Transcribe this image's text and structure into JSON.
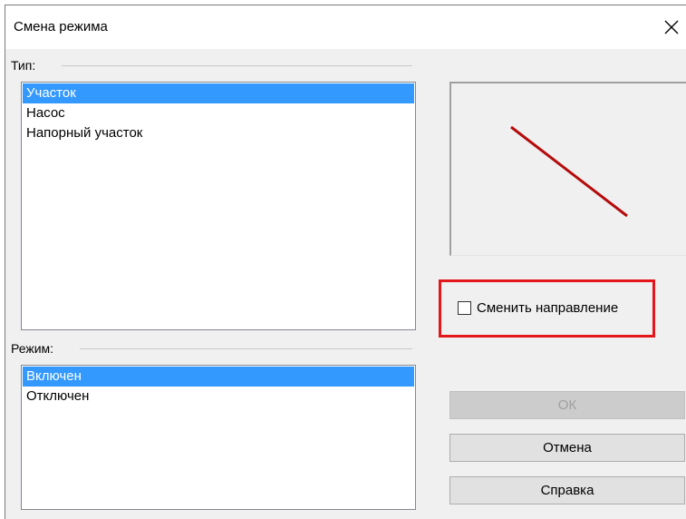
{
  "window": {
    "title": "Смена режима",
    "close_icon": "close-icon"
  },
  "type_group": {
    "label": "Тип:",
    "items": [
      {
        "label": "Участок",
        "selected": true
      },
      {
        "label": "Насос",
        "selected": false
      },
      {
        "label": "Напорный участок",
        "selected": false
      }
    ]
  },
  "mode_group": {
    "label": "Режим:",
    "items": [
      {
        "label": "Включен",
        "selected": true
      },
      {
        "label": "Отключен",
        "selected": false
      }
    ]
  },
  "preview": {
    "line_color": "#b40c0c"
  },
  "options": {
    "change_direction_label": "Сменить направление",
    "change_direction_checked": false,
    "highlight_color": "#e3161c"
  },
  "buttons": {
    "ok_label": "ОК",
    "ok_enabled": false,
    "cancel_label": "Отмена",
    "help_label": "Справка"
  },
  "colors": {
    "selection": "#3399ff",
    "dialog_bg": "#f0f0f0"
  }
}
